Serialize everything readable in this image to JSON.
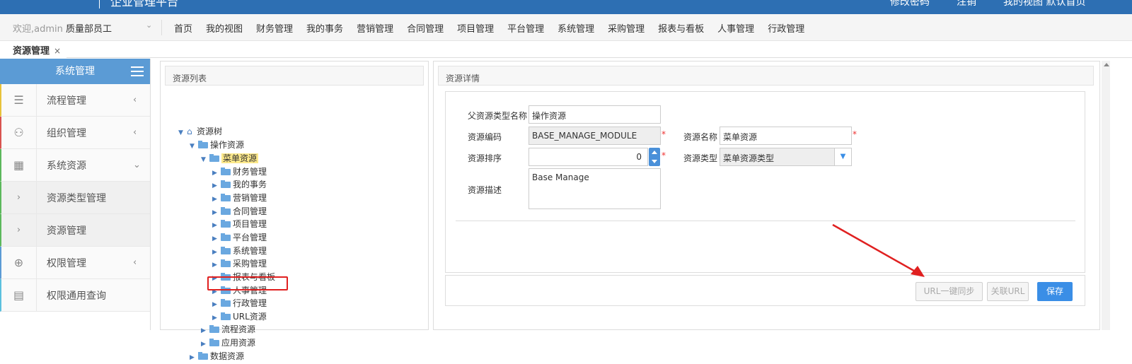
{
  "header": {
    "app_title": "企业管理平台",
    "links": [
      "修改密码",
      "注销",
      "我的视图 默认首页"
    ]
  },
  "navbar": {
    "welcome_prefix": "欢迎,",
    "user": "admin",
    "role": "质量部员工",
    "menu": [
      "首页",
      "我的视图",
      "财务管理",
      "我的事务",
      "营销管理",
      "合同管理",
      "项目管理",
      "平台管理",
      "系统管理",
      "采购管理",
      "报表与看板",
      "人事管理",
      "行政管理"
    ]
  },
  "tabs": {
    "active": "资源管理",
    "close": "×"
  },
  "sidebar": {
    "title": "系统管理",
    "items": [
      {
        "label": "流程管理",
        "icon": "list-icon",
        "arrow": "‹"
      },
      {
        "label": "组织管理",
        "icon": "org-icon",
        "arrow": "‹"
      },
      {
        "label": "系统资源",
        "icon": "resource-icon",
        "arrow": "⌄"
      },
      {
        "label": "资源类型管理",
        "icon": "chevron-right-icon",
        "arrow": ""
      },
      {
        "label": "资源管理",
        "icon": "chevron-right-icon",
        "arrow": ""
      },
      {
        "label": "权限管理",
        "icon": "lock-icon",
        "arrow": "‹"
      },
      {
        "label": "权限通用查询",
        "icon": "query-icon",
        "arrow": ""
      }
    ]
  },
  "left_panel": {
    "title": "资源列表",
    "tree": {
      "root": "资源树",
      "op": "操作资源",
      "menu": "菜单资源",
      "menu_children": [
        "财务管理",
        "我的事务",
        "营销管理",
        "合同管理",
        "项目管理",
        "平台管理",
        "系统管理",
        "采购管理",
        "报表与看板",
        "人事管理",
        "行政管理",
        "URL资源"
      ],
      "flow": "流程资源",
      "app": "应用资源",
      "data": "数据资源"
    }
  },
  "right_panel": {
    "title": "资源详情",
    "fields": {
      "parent_type_label": "父资源类型名称",
      "parent_type_value": "操作资源",
      "code_label": "资源编码",
      "code_value": "BASE_MANAGE_MODULE",
      "name_label": "资源名称",
      "name_value": "菜单资源",
      "order_label": "资源排序",
      "order_value": "0",
      "type_label": "资源类型",
      "type_value": "菜单资源类型",
      "desc_label": "资源描述",
      "desc_value": "Base Manage",
      "required_mark": "*"
    },
    "buttons": {
      "sync": "URL一键同步",
      "link": "关联URL",
      "save": "保存"
    }
  },
  "colors": {
    "header": "#2d6fb3",
    "sidebar_head": "#5b9bd5",
    "primary_btn": "#3a8ee6",
    "highlight": "#fde98b",
    "annotation": "#e02020"
  }
}
